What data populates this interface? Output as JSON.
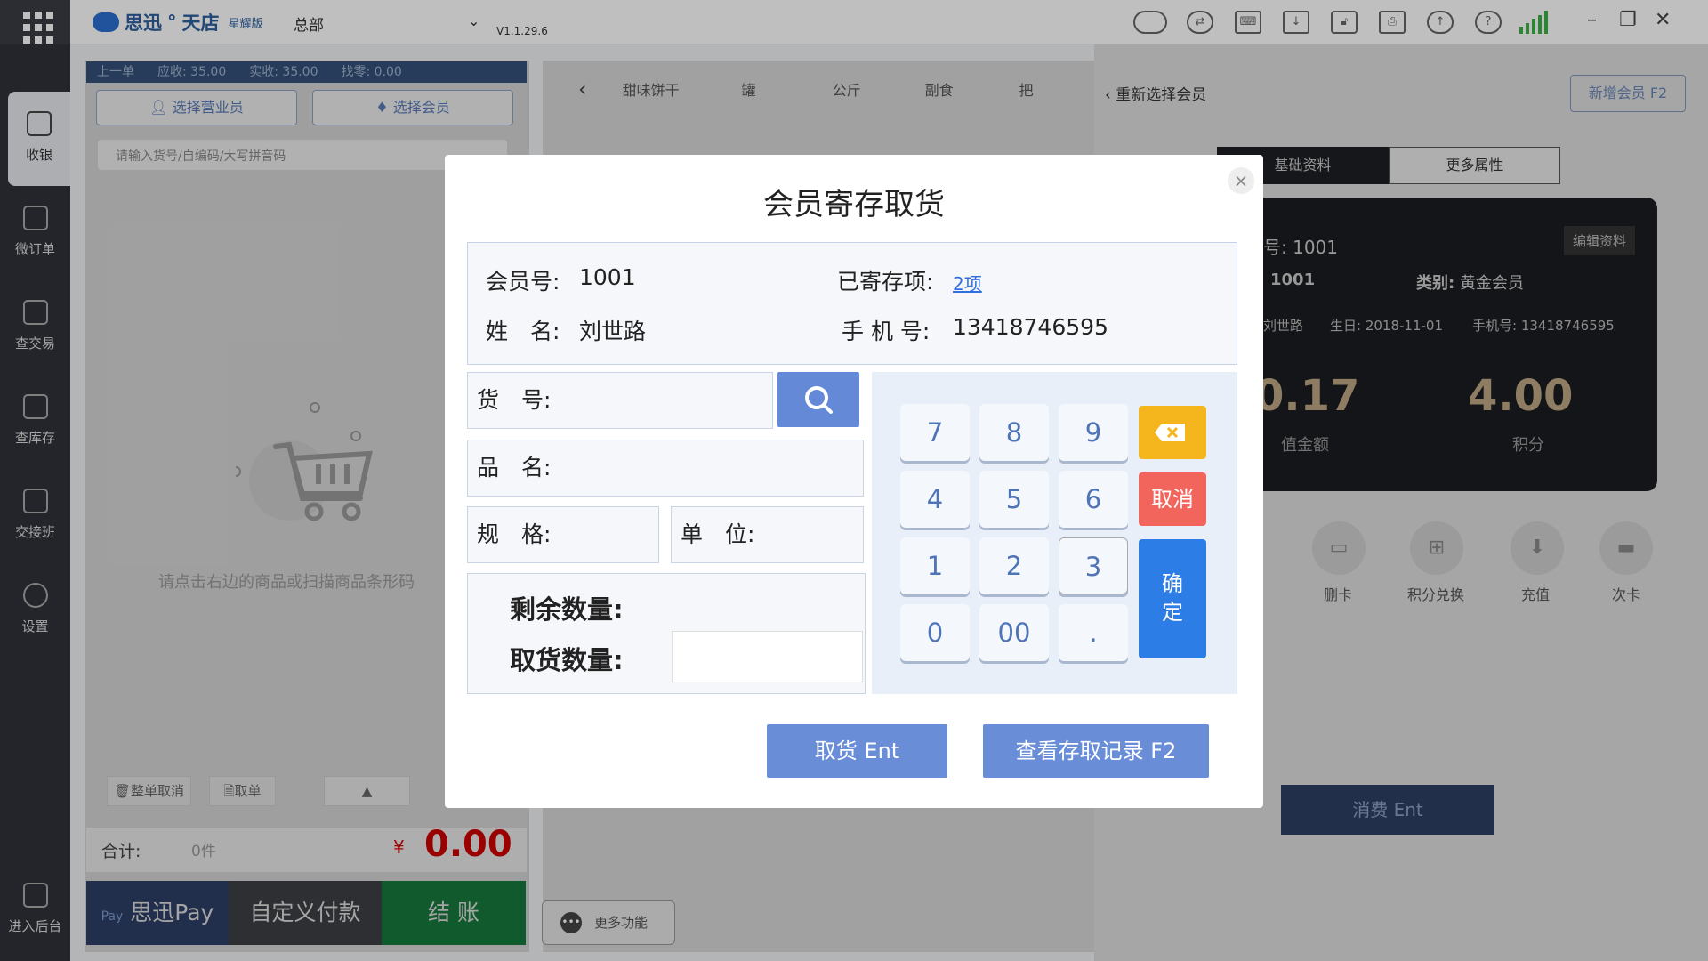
{
  "topbar": {
    "brand": "思迅",
    "brand2": "天店",
    "edition": "星耀版",
    "store": "总部",
    "version": "V1.1.29.6"
  },
  "sidebar": {
    "items": [
      {
        "label": "收银",
        "icon": "cash-icon"
      },
      {
        "label": "微订单",
        "icon": "order-icon"
      },
      {
        "label": "查交易",
        "icon": "receipt-icon"
      },
      {
        "label": "查库存",
        "icon": "warehouse-icon"
      },
      {
        "label": "交接班",
        "icon": "handover-icon"
      },
      {
        "label": "设置",
        "icon": "gear-icon"
      }
    ],
    "backend": "进入后台"
  },
  "left": {
    "info": {
      "prev": "上一单",
      "due": "应收: 35.00",
      "paid": "实收: 35.00",
      "change": "找零: 0.00"
    },
    "select_staff": "选择营业员",
    "select_member": "选择会员",
    "search_placeholder": "请输入货号/自编码/大写拼音码",
    "empty_tip": "请点击右边的商品或扫描商品条形码",
    "cancel_order": "整单取消",
    "take_order": "取单",
    "total_label": "合计:",
    "total_count": "0件",
    "currency": "¥",
    "total_amount": "0.00",
    "pay_sixun": "思迅Pay",
    "pay_custom": "自定义付款",
    "checkout": "结 账"
  },
  "middle": {
    "categories": [
      "甜味饼干",
      "罐",
      "公斤",
      "副食",
      "把"
    ],
    "more_functions": "更多功能"
  },
  "right": {
    "reselect": "重新选择会员",
    "new_member": "新增会员 F2",
    "tab_basic": "基础资料",
    "tab_more": "更多属性",
    "card": {
      "edit": "编辑资料",
      "member_no_label": "号:",
      "member_no": "1001",
      "code": "1001",
      "type_label": "类别:",
      "type": "黄金会员",
      "name": "刘世路",
      "birthday_label": "生日:",
      "birthday": "2018-11-01",
      "phone_label": "手机号:",
      "phone": "13418746595",
      "balance": "0.17",
      "balance_label": "值金额",
      "points": "4.00",
      "points_label": "积分"
    },
    "functions": [
      {
        "label": "删卡",
        "icon": "card-icon"
      },
      {
        "label": "积分兑换",
        "icon": "gift-icon"
      },
      {
        "label": "充值",
        "icon": "recharge-icon"
      },
      {
        "label": "次卡",
        "icon": "ticket-icon"
      }
    ],
    "consume": "消费 Ent"
  },
  "modal": {
    "title": "会员寄存取货",
    "member_no_label": "会员号:",
    "member_no": "1001",
    "deposited_label": "已寄存项:",
    "deposited_link": "2项",
    "name_label": "姓　名:",
    "name": "刘世路",
    "phone_label": "手 机 号:",
    "phone": "13418746595",
    "item_no_label": "货　号:",
    "product_name_label": "品　名:",
    "spec_label": "规　格:",
    "unit_label": "单　位:",
    "remaining_label": "剩余数量:",
    "pickup_label": "取货数量:",
    "keys": [
      "7",
      "8",
      "9",
      "4",
      "5",
      "6",
      "1",
      "2",
      "3",
      "0",
      "00",
      "."
    ],
    "cancel": "取消",
    "confirm": "确定",
    "pickup_button": "取货 Ent",
    "records_button": "查看存取记录 F2"
  }
}
